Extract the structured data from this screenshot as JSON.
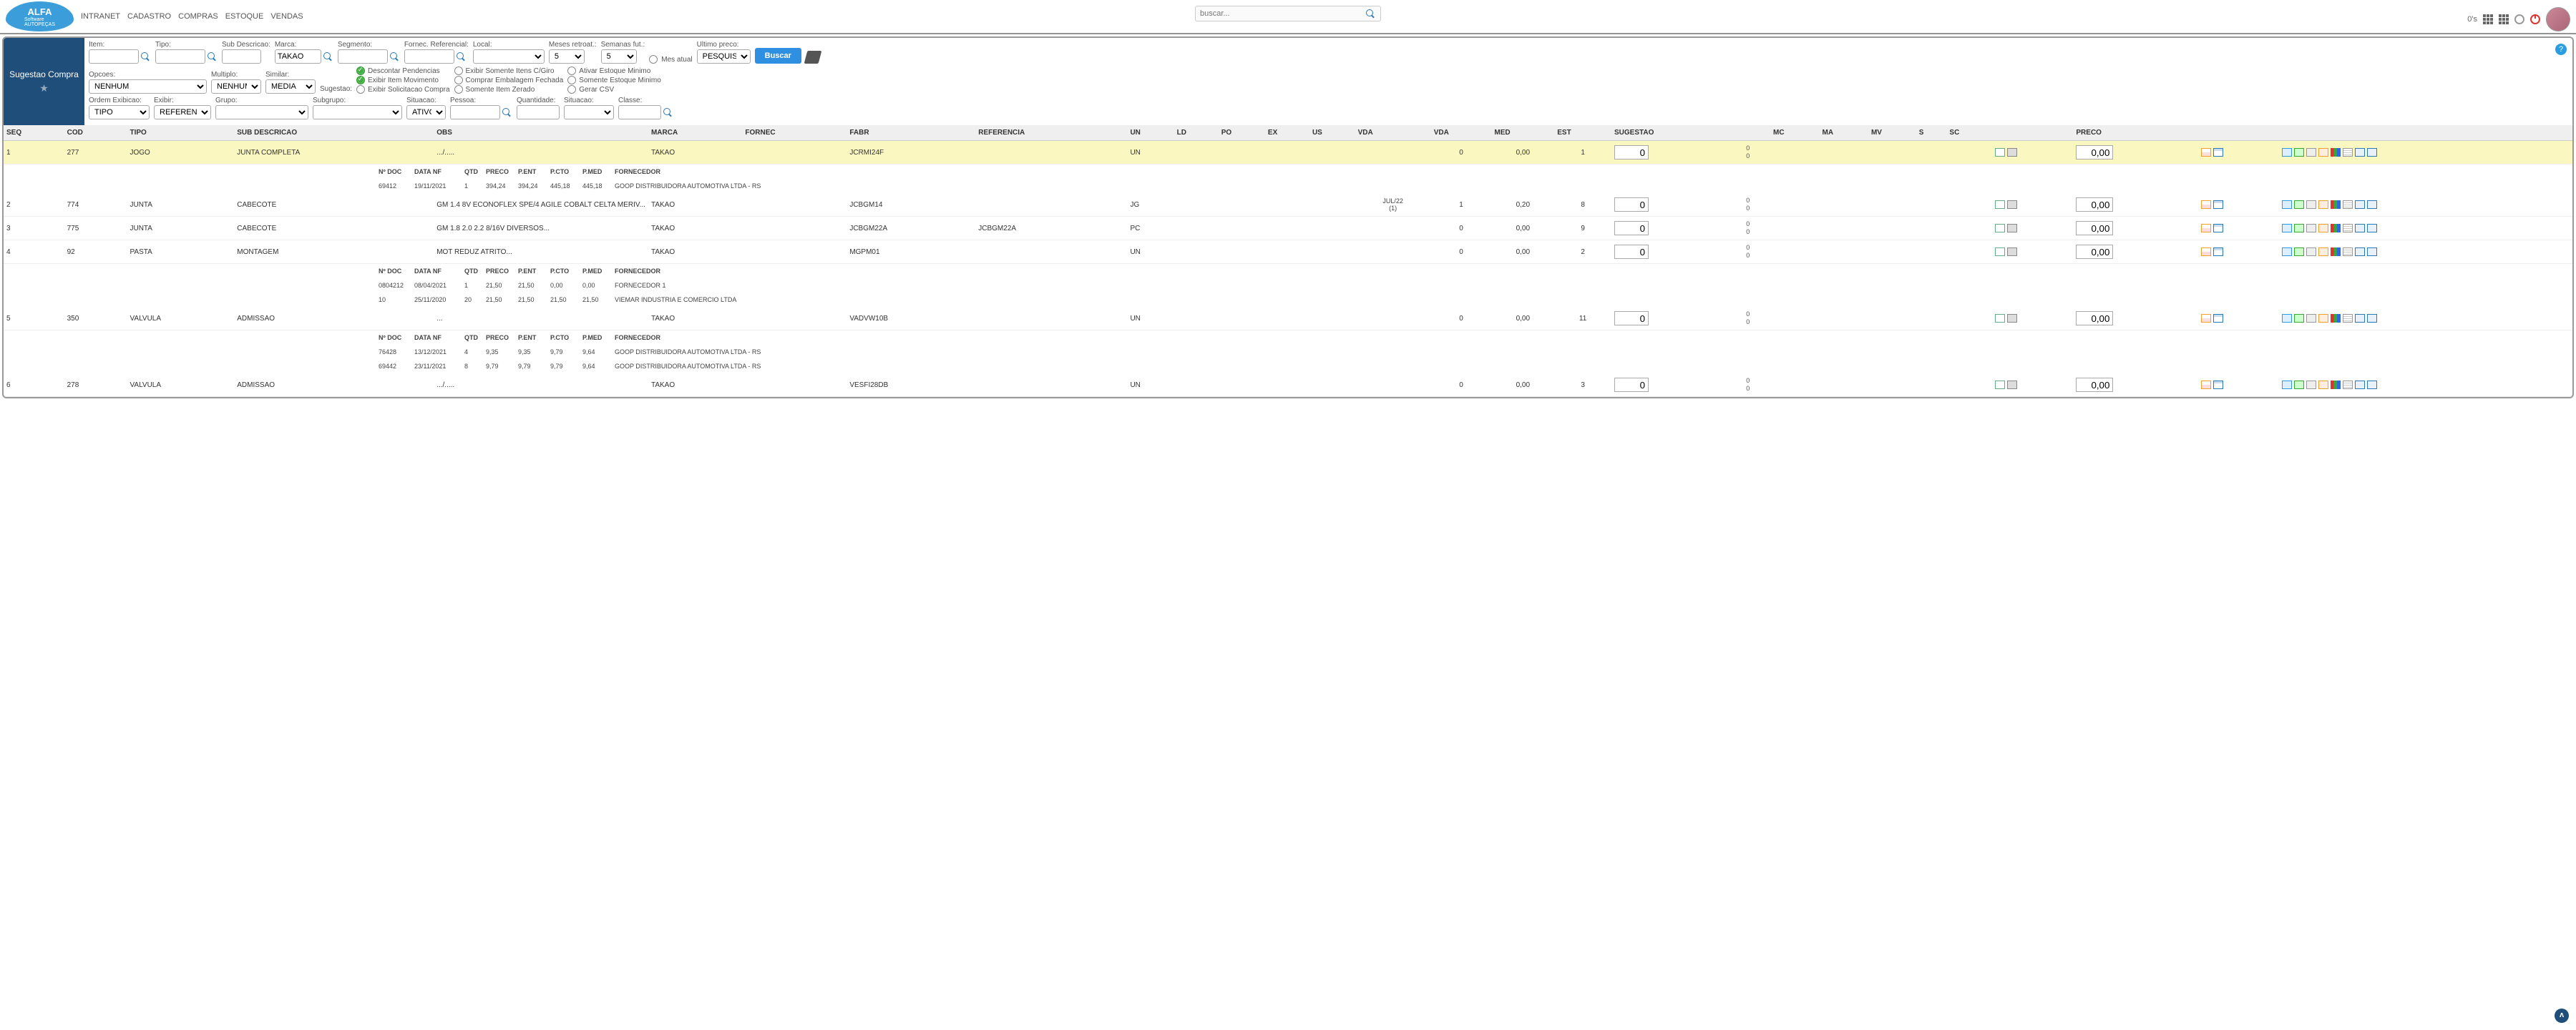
{
  "search_placeholder": "buscar...",
  "nav": {
    "intranet": "INTRANET",
    "cadastro": "CADASTRO",
    "compras": "COMPRAS",
    "estoque": "ESTOQUE",
    "vendas": "VENDAS"
  },
  "topright": {
    "zeros": "0's"
  },
  "side": {
    "title": "Sugestao Compra"
  },
  "labels": {
    "item": "Item:",
    "tipo": "Tipo:",
    "subdesc": "Sub Descricao:",
    "marca": "Marca:",
    "segmento": "Segmento:",
    "fornec": "Fornec. Referencial:",
    "local": "Local:",
    "mesesr": "Meses retroat.:",
    "semanas": "Semanas fut.:",
    "mesatual": "Mes atual",
    "ultimopreco": "Ultimo preco:",
    "opcoes": "Opcoes:",
    "multiplo": "Multiplo:",
    "similar": "Similar:",
    "sugestao": "Sugestao:",
    "ordem": "Ordem Exibicao:",
    "exibir": "Exibir:",
    "grupo": "Grupo:",
    "subgrupo": "Subgrupo:",
    "situacao": "Situacao:",
    "pessoa": "Pessoa:",
    "quantidade": "Quantidade:",
    "situacao2": "Situacao:",
    "classe": "Classe:"
  },
  "vals": {
    "marca": "TAKAO",
    "meses": "5",
    "semanas": "5",
    "ultimopreco": "PESQUISA",
    "opcoes": "NENHUM",
    "multiplo": "NENHUM",
    "similar": "MEDIA",
    "ordem": "TIPO",
    "exibir": "REFERENCIA",
    "situacao": "ATIVO"
  },
  "chks": {
    "desc_pend": "Descontar Pendencias",
    "exib_giro": "Exibir Somente Itens C/Giro",
    "ativ_est": "Ativar Estoque Minimo",
    "exib_mov": "Exibir Item Movimento",
    "comp_emb": "Comprar Embalagem Fechada",
    "som_est": "Somente Estoque Minimo",
    "exib_sol": "Exibir Solicitacao Compra",
    "som_zero": "Somente Item Zerado",
    "csv": "Gerar CSV"
  },
  "btn": {
    "buscar": "Buscar"
  },
  "th": {
    "seq": "SEQ",
    "cod": "COD",
    "tipo": "TIPO",
    "subd": "SUB DESCRICAO",
    "obs": "OBS",
    "marca": "MARCA",
    "fornec": "FORNEC",
    "fabr": "FABR",
    "ref": "REFERENCIA",
    "un": "UN",
    "ld": "LD",
    "po": "PO",
    "ex": "EX",
    "us": "US",
    "vda": "VDA",
    "vda2": "VDA",
    "med": "MED",
    "est": "EST",
    "sug": "SUGESTAO",
    "mc": "MC",
    "ma": "MA",
    "mv": "MV",
    "s": "S",
    "sc": "SC",
    "preco": "PRECO"
  },
  "subth": {
    "ndoc": "Nº DOC",
    "datanf": "DATA NF",
    "qtd": "QTD",
    "preco": "PRECO",
    "pent": "P.ENT",
    "pcto": "P.CTO",
    "pmed": "P.MED",
    "forn": "FORNECEDOR"
  },
  "rows": [
    {
      "seq": "1",
      "cod": "277",
      "tipo": "JOGO",
      "subd": "JUNTA COMPLETA",
      "obs": ".../.....",
      "marca": "TAKAO",
      "fabr": "JCRMI24F",
      "ref": "",
      "un": "UN",
      "vda_txt": "",
      "vda2": "0",
      "med": "0,00",
      "est": "1",
      "sug": "0",
      "preco": "0,00",
      "hl": true,
      "subs": [
        [
          "69412",
          "19/11/2021",
          "1",
          "394,24",
          "394,24",
          "445,18",
          "445,18",
          "GOOP DISTRIBUIDORA AUTOMOTIVA LTDA - RS"
        ]
      ]
    },
    {
      "seq": "2",
      "cod": "774",
      "tipo": "JUNTA",
      "subd": "CABECOTE",
      "obs": "GM 1.4 8V ECONOFLEX SPE/4 AGILE COBALT CELTA MERIV...",
      "marca": "TAKAO",
      "fabr": "JCBGM14",
      "ref": "",
      "un": "JG",
      "vda_txt": "JUL/22|(1)",
      "vda2": "1",
      "med": "0,20",
      "est": "8",
      "sug": "0",
      "preco": "0,00"
    },
    {
      "seq": "3",
      "cod": "775",
      "tipo": "JUNTA",
      "subd": "CABECOTE",
      "obs": "GM 1.8 2.0 2.2 8/16V DIVERSOS...",
      "marca": "TAKAO",
      "fabr": "JCBGM22A",
      "ref": "JCBGM22A",
      "un": "PC",
      "vda_txt": "",
      "vda2": "0",
      "med": "0,00",
      "est": "9",
      "sug": "0",
      "preco": "0,00"
    },
    {
      "seq": "4",
      "cod": "92",
      "tipo": "PASTA",
      "subd": "MONTAGEM",
      "obs": "MOT REDUZ ATRITO...",
      "marca": "TAKAO",
      "fabr": "MGPM01",
      "ref": "",
      "un": "UN",
      "vda_txt": "",
      "vda2": "0",
      "med": "0,00",
      "est": "2",
      "sug": "0",
      "preco": "0,00",
      "subs": [
        [
          "0804212",
          "08/04/2021",
          "1",
          "21,50",
          "21,50",
          "0,00",
          "0,00",
          "FORNECEDOR 1"
        ],
        [
          "10",
          "25/11/2020",
          "20",
          "21,50",
          "21,50",
          "21,50",
          "21,50",
          "VIEMAR INDUSTRIA E COMERCIO LTDA"
        ]
      ]
    },
    {
      "seq": "5",
      "cod": "350",
      "tipo": "VALVULA",
      "subd": "ADMISSAO",
      "obs": "...",
      "marca": "TAKAO",
      "fabr": "VADVW10B",
      "ref": "",
      "un": "UN",
      "vda_txt": "",
      "vda2": "0",
      "med": "0,00",
      "est": "11",
      "sug": "0",
      "preco": "0,00",
      "subs": [
        [
          "76428",
          "13/12/2021",
          "4",
          "9,35",
          "9,35",
          "9,79",
          "9,64",
          "GOOP DISTRIBUIDORA AUTOMOTIVA LTDA - RS"
        ],
        [
          "69442",
          "23/11/2021",
          "8",
          "9,79",
          "9,79",
          "9,79",
          "9,64",
          "GOOP DISTRIBUIDORA AUTOMOTIVA LTDA - RS"
        ]
      ]
    },
    {
      "seq": "6",
      "cod": "278",
      "tipo": "VALVULA",
      "subd": "ADMISSAO",
      "obs": ".../.....",
      "marca": "TAKAO",
      "fabr": "VESFI28DB",
      "ref": "",
      "un": "UN",
      "vda_txt": "",
      "vda2": "0",
      "med": "0,00",
      "est": "3",
      "sug": "0",
      "preco": "0,00"
    }
  ]
}
